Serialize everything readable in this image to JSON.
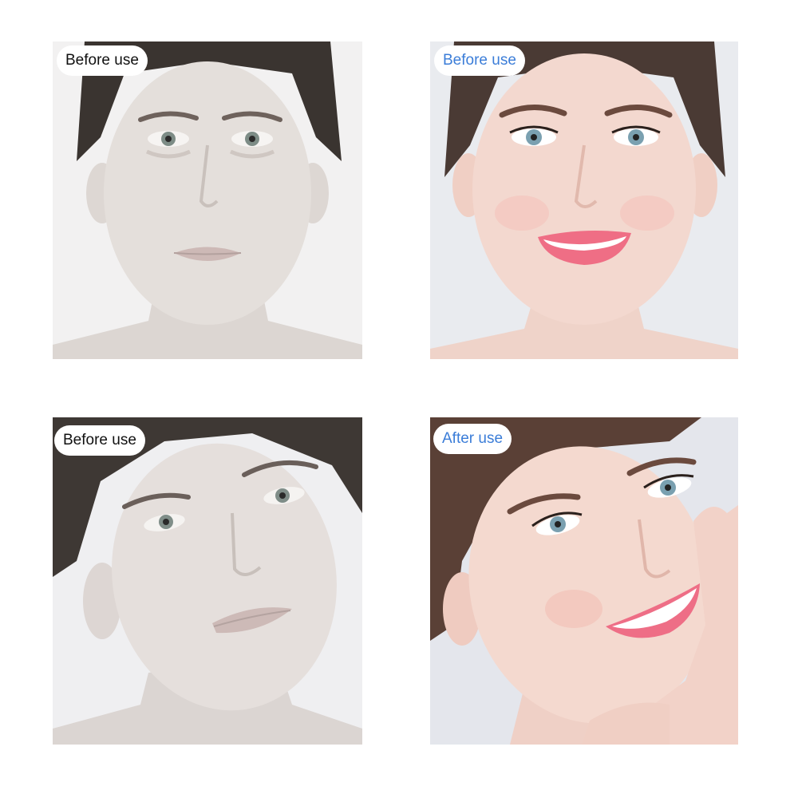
{
  "panels": [
    {
      "label": "Before use",
      "label_color": "#111111",
      "skin": "#e4dfdb",
      "lips": "#cdb9b6",
      "hair": "#3a3430",
      "bg": "#f2f1f1"
    },
    {
      "label": "Before use",
      "label_color": "#3b7dd8",
      "skin": "#f3d8cf",
      "lips": "#ef6e85",
      "hair": "#4a3a34",
      "bg": "#e9ebef"
    },
    {
      "label": "Before use",
      "label_color": "#111111",
      "skin": "#e5dfdc",
      "lips": "#cdbab7",
      "hair": "#3e3834",
      "bg": "#efeff1"
    },
    {
      "label": "After use",
      "label_color": "#3b7dd8",
      "skin": "#f4d9cf",
      "lips": "#ee6e86",
      "hair": "#5a4036",
      "bg": "#e4e6ec"
    }
  ]
}
